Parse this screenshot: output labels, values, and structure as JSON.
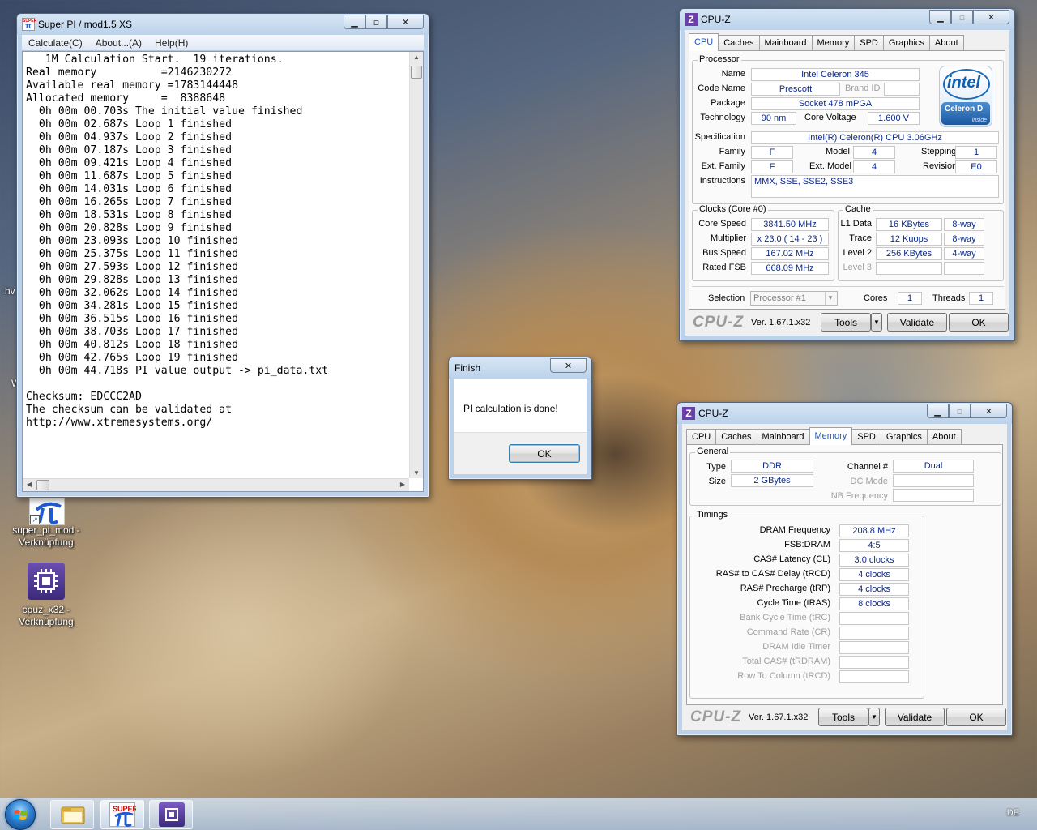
{
  "desktop": {
    "edge_labels": [
      "hv",
      "W"
    ],
    "icons": [
      {
        "label_line1": "super_pi_mod -",
        "label_line2": "Verknüpfung"
      },
      {
        "label_line1": "cpuz_x32 -",
        "label_line2": "Verknüpfung"
      }
    ]
  },
  "superpi": {
    "title": "Super PI / mod1.5 XS",
    "icon_text_top": "SUPER",
    "icon_text_bottom": "π",
    "menu": [
      "Calculate(C)",
      "About...(A)",
      "Help(H)"
    ],
    "output_lines": [
      "   1M Calculation Start.  19 iterations.",
      "Real memory          =2146230272",
      "Available real memory =1783144448",
      "Allocated memory     =  8388648",
      "  0h 00m 00.703s The initial value finished",
      "  0h 00m 02.687s Loop 1 finished",
      "  0h 00m 04.937s Loop 2 finished",
      "  0h 00m 07.187s Loop 3 finished",
      "  0h 00m 09.421s Loop 4 finished",
      "  0h 00m 11.687s Loop 5 finished",
      "  0h 00m 14.031s Loop 6 finished",
      "  0h 00m 16.265s Loop 7 finished",
      "  0h 00m 18.531s Loop 8 finished",
      "  0h 00m 20.828s Loop 9 finished",
      "  0h 00m 23.093s Loop 10 finished",
      "  0h 00m 25.375s Loop 11 finished",
      "  0h 00m 27.593s Loop 12 finished",
      "  0h 00m 29.828s Loop 13 finished",
      "  0h 00m 32.062s Loop 14 finished",
      "  0h 00m 34.281s Loop 15 finished",
      "  0h 00m 36.515s Loop 16 finished",
      "  0h 00m 38.703s Loop 17 finished",
      "  0h 00m 40.812s Loop 18 finished",
      "  0h 00m 42.765s Loop 19 finished",
      "  0h 00m 44.718s PI value output -> pi_data.txt",
      "",
      "Checksum: EDCCC2AD",
      "The checksum can be validated at",
      "http://www.xtremesystems.org/"
    ]
  },
  "finish_dialog": {
    "title": "Finish",
    "message": "PI calculation is done!",
    "ok_label": "OK"
  },
  "cpuz_cpu": {
    "title": "CPU-Z",
    "tabs": [
      "CPU",
      "Caches",
      "Mainboard",
      "Memory",
      "SPD",
      "Graphics",
      "About"
    ],
    "active_tab": "CPU",
    "processor": {
      "group": "Processor",
      "name_label": "Name",
      "name": "Intel Celeron 345",
      "codename_label": "Code Name",
      "codename": "Prescott",
      "brandid_label": "Brand ID",
      "brandid": "",
      "package_label": "Package",
      "package": "Socket 478 mPGA",
      "technology_label": "Technology",
      "technology": "90 nm",
      "voltage_label": "Core Voltage",
      "voltage": "1.600 V",
      "spec_label": "Specification",
      "spec": "Intel(R) Celeron(R) CPU 3.06GHz",
      "family_label": "Family",
      "family": "F",
      "model_label": "Model",
      "model": "4",
      "stepping_label": "Stepping",
      "stepping": "1",
      "extfamily_label": "Ext. Family",
      "extfamily": "F",
      "extmodel_label": "Ext. Model",
      "extmodel": "4",
      "revision_label": "Revision",
      "revision": "E0",
      "instructions_label": "Instructions",
      "instructions": "MMX, SSE, SSE2, SSE3"
    },
    "logo": {
      "brand": "intel",
      "product": "Celeron D",
      "inside": "inside"
    },
    "clocks": {
      "group": "Clocks (Core #0)",
      "core_speed_label": "Core Speed",
      "core_speed": "3841.50 MHz",
      "multiplier_label": "Multiplier",
      "multiplier": "x 23.0 ( 14 - 23 )",
      "bus_speed_label": "Bus Speed",
      "bus_speed": "167.02 MHz",
      "rated_fsb_label": "Rated FSB",
      "rated_fsb": "668.09 MHz"
    },
    "cache": {
      "group": "Cache",
      "l1_label": "L1 Data",
      "l1_size": "16 KBytes",
      "l1_way": "8-way",
      "trace_label": "Trace",
      "trace_size": "12 Kuops",
      "trace_way": "8-way",
      "l2_label": "Level 2",
      "l2_size": "256 KBytes",
      "l2_way": "4-way",
      "l3_label": "Level 3",
      "l3_size": "",
      "l3_way": ""
    },
    "selection_label": "Selection",
    "selection": "Processor #1",
    "cores_label": "Cores",
    "cores": "1",
    "threads_label": "Threads",
    "threads": "1",
    "footer": {
      "logo": "CPU-Z",
      "version": "Ver. 1.67.1.x32",
      "tools": "Tools",
      "validate": "Validate",
      "ok": "OK"
    }
  },
  "cpuz_mem": {
    "title": "CPU-Z",
    "tabs": [
      "CPU",
      "Caches",
      "Mainboard",
      "Memory",
      "SPD",
      "Graphics",
      "About"
    ],
    "active_tab": "Memory",
    "general": {
      "group": "General",
      "type_label": "Type",
      "type": "DDR",
      "size_label": "Size",
      "size": "2 GBytes",
      "channel_label": "Channel #",
      "channel": "Dual",
      "dcmode_label": "DC Mode",
      "dcmode": "",
      "nbfreq_label": "NB Frequency",
      "nbfreq": ""
    },
    "timings": {
      "group": "Timings",
      "rows": [
        {
          "label": "DRAM Frequency",
          "value": "208.8 MHz",
          "dim": false
        },
        {
          "label": "FSB:DRAM",
          "value": "4:5",
          "dim": false
        },
        {
          "label": "CAS# Latency (CL)",
          "value": "3.0 clocks",
          "dim": false
        },
        {
          "label": "RAS# to CAS# Delay (tRCD)",
          "value": "4 clocks",
          "dim": false
        },
        {
          "label": "RAS# Precharge (tRP)",
          "value": "4 clocks",
          "dim": false
        },
        {
          "label": "Cycle Time (tRAS)",
          "value": "8 clocks",
          "dim": false
        },
        {
          "label": "Bank Cycle Time (tRC)",
          "value": "",
          "dim": true
        },
        {
          "label": "Command Rate (CR)",
          "value": "",
          "dim": true
        },
        {
          "label": "DRAM Idle Timer",
          "value": "",
          "dim": true
        },
        {
          "label": "Total CAS# (tRDRAM)",
          "value": "",
          "dim": true
        },
        {
          "label": "Row To Column (tRCD)",
          "value": "",
          "dim": true
        }
      ]
    },
    "footer": {
      "logo": "CPU-Z",
      "version": "Ver. 1.67.1.x32",
      "tools": "Tools",
      "validate": "Validate",
      "ok": "OK"
    }
  },
  "taskbar": {
    "language": "DE",
    "pinned": [
      "explorer",
      "super_pi",
      "cpu-z"
    ]
  }
}
